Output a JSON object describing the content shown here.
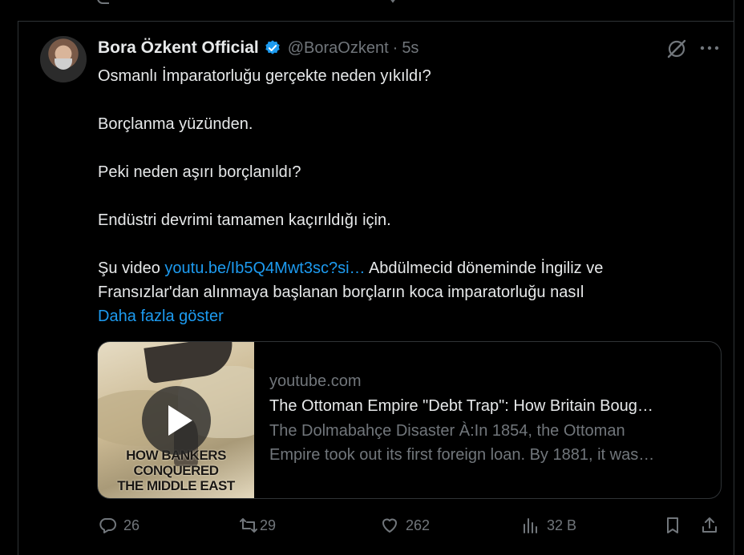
{
  "tweet": {
    "author": {
      "display_name": "Bora Özkent Official",
      "handle": "@BoraOzkent",
      "separator": "·",
      "time": "5s"
    },
    "body": {
      "line1": "Osmanlı İmparatorluğu gerçekte neden yıkıldı?",
      "line2": "Borçlanma yüzünden.",
      "line3": "Peki neden aşırı borçlanıldı?",
      "line4": "Endüstri devrimi tamamen kaçırıldığı için.",
      "line5_prefix": "Şu video ",
      "line5_link": "youtu.be/Ib5Q4Mwt3sc?si…",
      "line5_suffix": " Abdülmecid döneminde İngiliz ve",
      "line6": "Fransızlar'dan alınmaya başlanan borçların koca imparatorluğu nasıl",
      "show_more": "Daha fazla göster"
    },
    "card": {
      "domain": "youtube.com",
      "title": "The Ottoman Empire \"Debt Trap\": How Britain Boug…",
      "desc_line1": "The Dolmabahçe Disaster À:In 1854, the Ottoman",
      "desc_line2": "Empire took out its first foreign loan. By 1881, it was…",
      "thumb_caption_1": "HOW BANKERS CONQUERED",
      "thumb_caption_2": "THE MIDDLE EAST"
    },
    "actions": {
      "replies": "26",
      "reposts": "29",
      "likes": "262",
      "views": "32 B"
    }
  },
  "colors": {
    "background": "#000000",
    "text": "#e7e9ea",
    "muted": "#71767b",
    "accent": "#1d9bf0",
    "border": "#2f3336"
  }
}
